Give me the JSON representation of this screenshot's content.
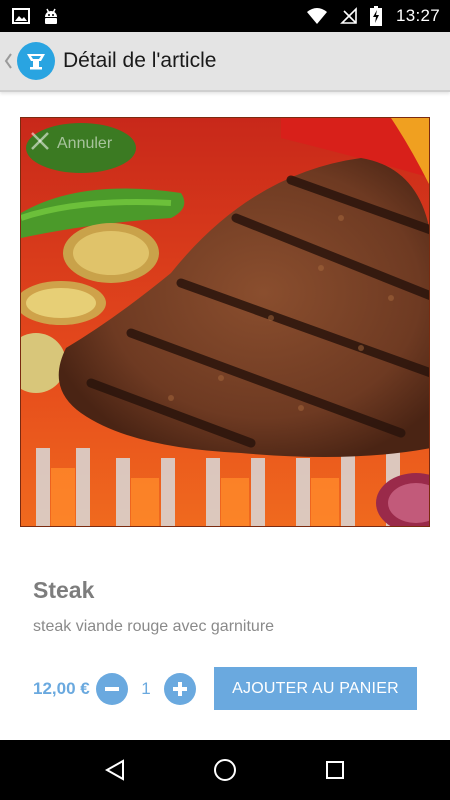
{
  "status_bar": {
    "time": "13:27",
    "icons": [
      "image-notification-icon",
      "android-debug-icon",
      "wifi-icon",
      "no-signal-icon",
      "battery-charging-icon"
    ]
  },
  "app_bar": {
    "title": "Détail de l'article",
    "back_icon": "chevron-left-icon",
    "logo_icon": "food-cover-logo-icon"
  },
  "image_overlay": {
    "cancel_label": "Annuler"
  },
  "product": {
    "name": "Steak",
    "description": "steak viande rouge avec garniture",
    "price": "12,00 €",
    "quantity": "1"
  },
  "actions": {
    "add_to_cart_label": "AJOUTER AU PANIER"
  },
  "colors": {
    "accent": "#6aa9df",
    "app_bar_bg": "#e4e4e4",
    "logo_bg": "#29a4e1",
    "text_gray": "#7d7d7d"
  },
  "nav_bar": {
    "icons": [
      "back-triangle-icon",
      "home-circle-icon",
      "recents-square-icon"
    ]
  }
}
